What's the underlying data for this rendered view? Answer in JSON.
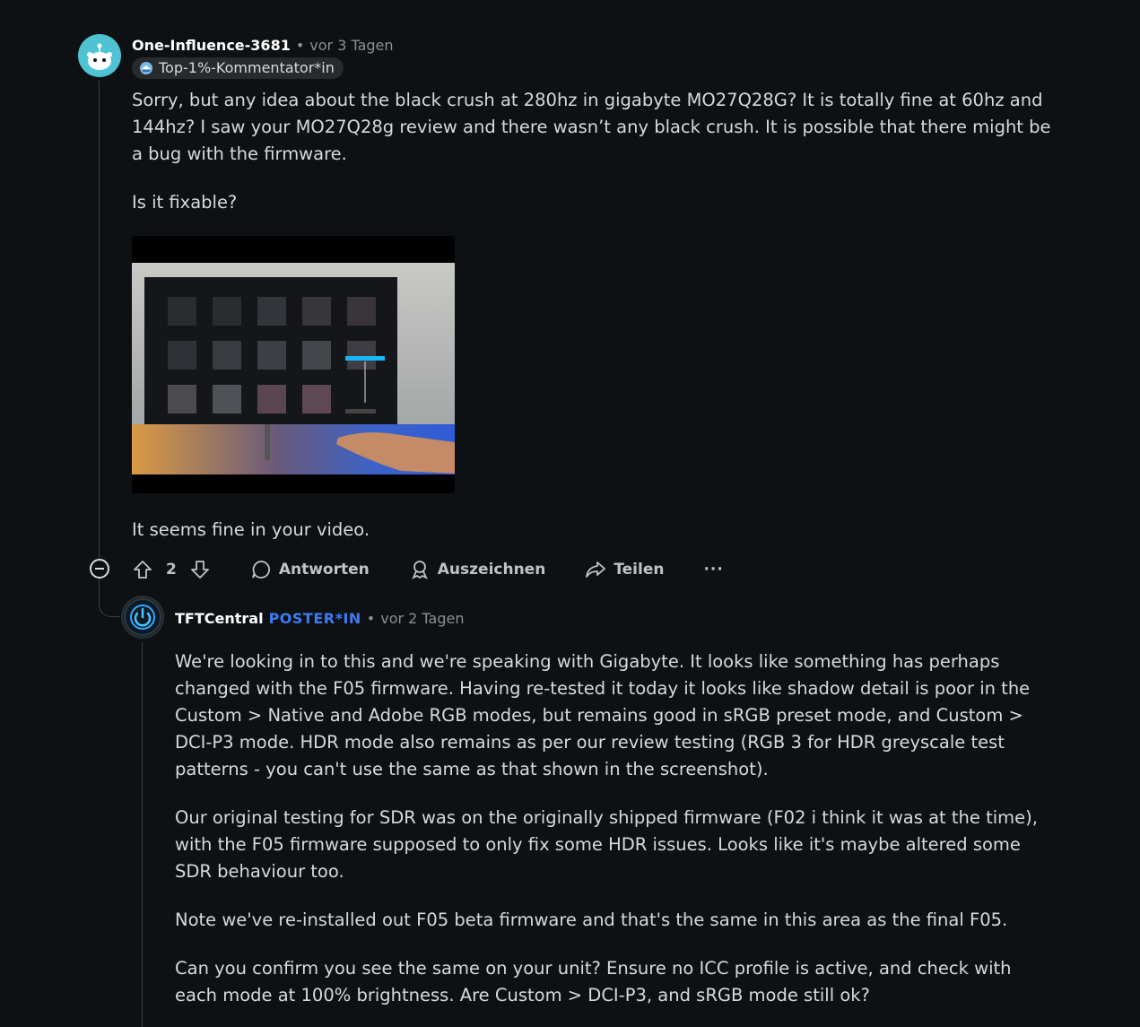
{
  "comment1": {
    "username": "One-Influence-3681",
    "separator": "•",
    "time": "vor 3 Tagen",
    "flair": "Top-1%-Kommentator*in",
    "paragraphs": [
      "Sorry, but any idea about the black crush at 280hz in gigabyte MO27Q28G? It is totally fine at 60hz and 144hz? I saw your MO27Q28g review and there wasn’t any black crush. It is possible that there might be a bug with the firmware.",
      "Is it fixable?"
    ],
    "after_image": "It seems fine in your video.",
    "votes": "2",
    "actions": {
      "reply": "Antworten",
      "award": "Auszeichnen",
      "share": "Teilen",
      "more": "···"
    }
  },
  "comment2": {
    "username": "TFTCentral",
    "badge": "POSTER*IN",
    "separator": "•",
    "time": "vor 2 Tagen",
    "paragraphs": [
      "We're looking in to this and we're speaking with Gigabyte. It looks like something has perhaps changed with the F05 firmware. Having re-tested it today it looks like shadow detail is poor in the Custom > Native and Adobe RGB modes, but remains good in sRGB preset mode, and Custom > DCI-P3 mode. HDR mode also remains as per our review testing (RGB 3 for HDR greyscale test patterns - you can't use the same as that shown in the screenshot).",
      "Our original testing for SDR was on the originally shipped firmware (F02 i think it was at the time), with the F05 firmware supposed to only fix some HDR issues. Looks like it's maybe altered some SDR behaviour too.",
      "Note we've re-installed out F05 beta firmware and that's the same in this area as the final F05.",
      "Can you confirm you see the same on your unit? Ensure no ICC profile is active, and check with each mode at 100% brightness. Are Custom > DCI-P3, and sRGB mode still ok?"
    ]
  }
}
